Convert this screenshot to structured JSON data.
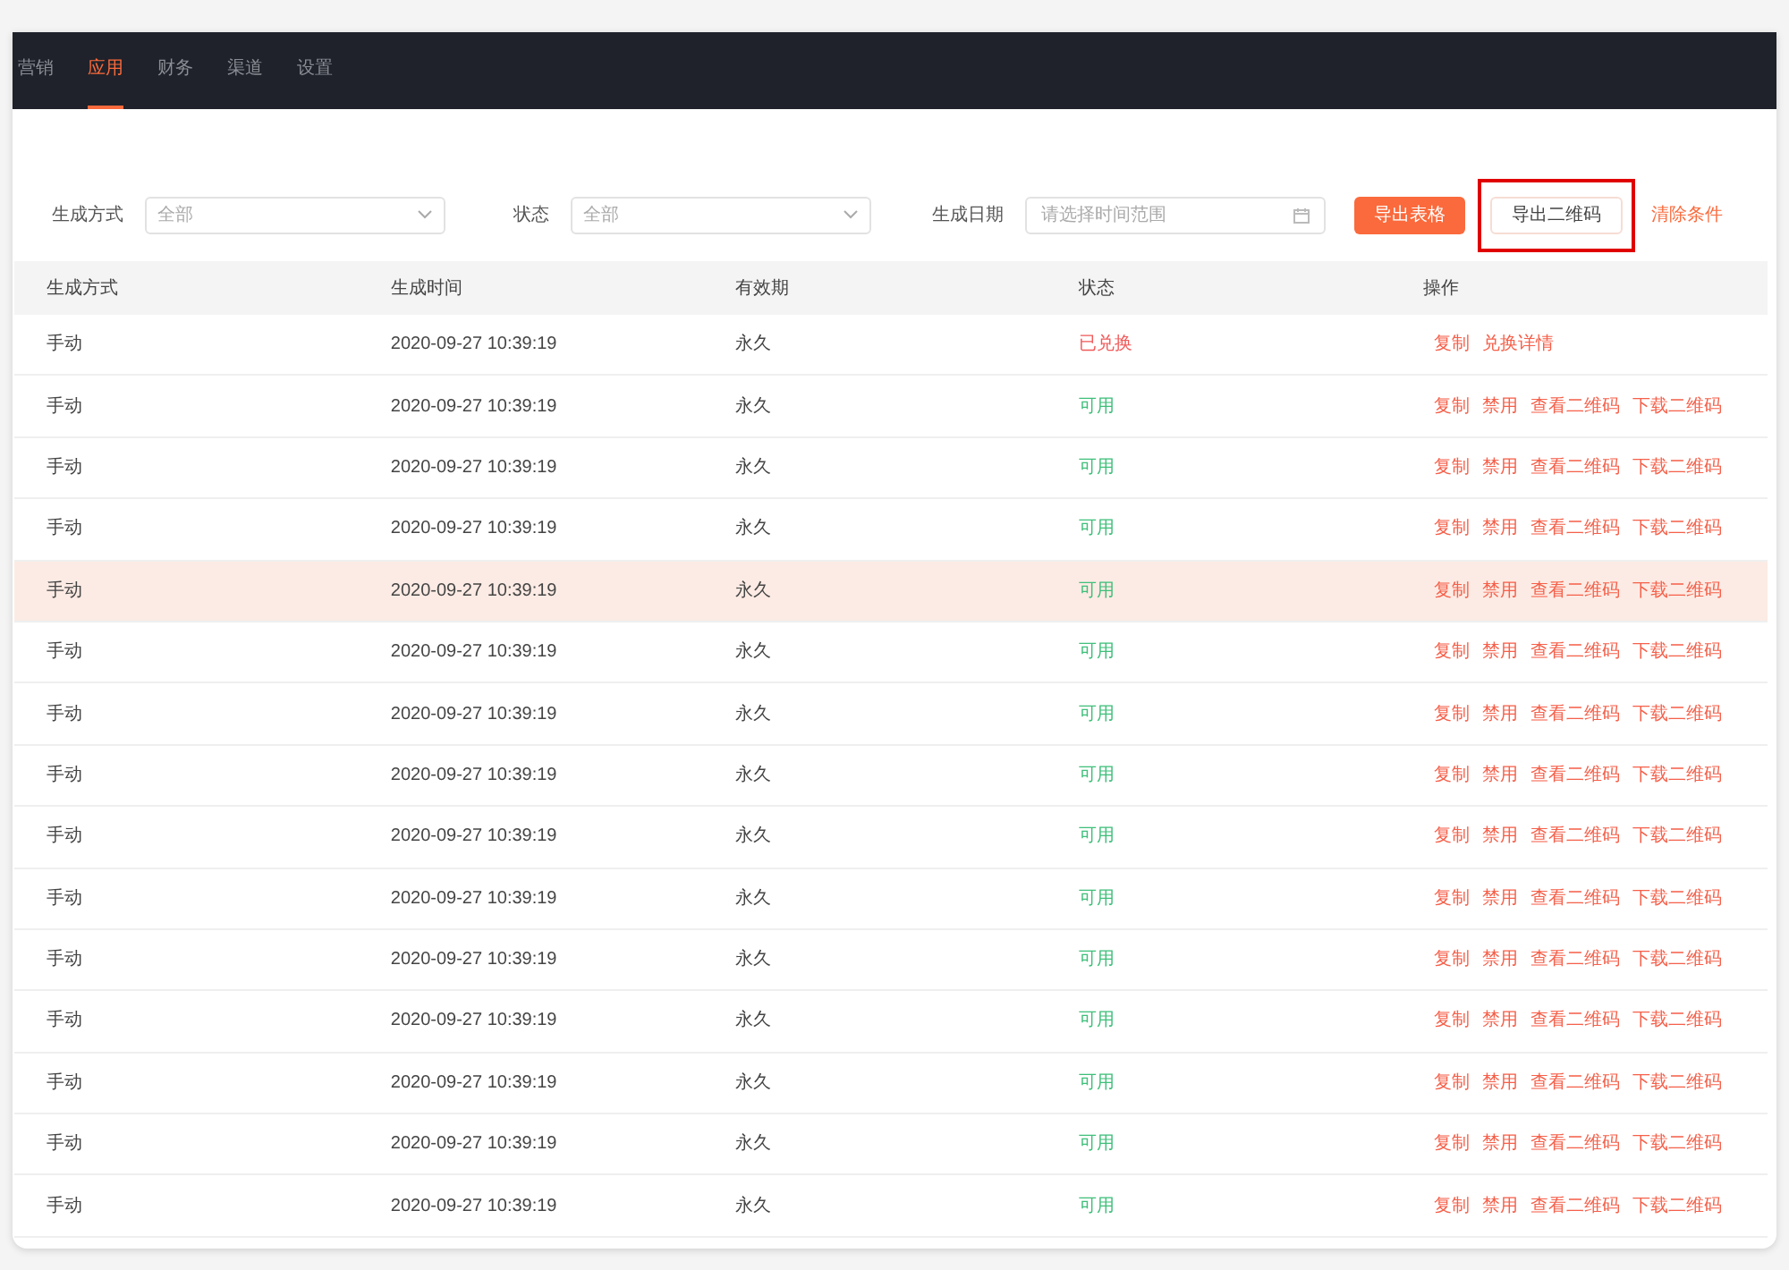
{
  "nav": {
    "tabs": [
      {
        "label": "营销",
        "selected": false
      },
      {
        "label": "应用",
        "selected": true
      },
      {
        "label": "财务",
        "selected": false
      },
      {
        "label": "渠道",
        "selected": false
      },
      {
        "label": "设置",
        "selected": false
      }
    ]
  },
  "filters": {
    "method": {
      "label": "生成方式",
      "value": "全部"
    },
    "status": {
      "label": "状态",
      "value": "全部"
    },
    "date": {
      "label": "生成日期",
      "placeholder": "请选择时间范围"
    }
  },
  "actions": [
    {
      "label": "导出表格",
      "kind": "primary",
      "highlighted": false
    },
    {
      "label": "导出二维码",
      "kind": "default",
      "highlighted": true
    },
    {
      "label": "清除条件",
      "kind": "text",
      "highlighted": false
    }
  ],
  "table": {
    "columns": [
      "生成方式",
      "生成时间",
      "有效期",
      "状态",
      "操作"
    ],
    "rows": [
      {
        "method": "手动",
        "time": "2020-09-27 10:39:19",
        "validity": "永久",
        "status": "已兑换",
        "kind": "redeemed",
        "highlighted": false,
        "ops": [
          "复制",
          "兑换详情"
        ]
      },
      {
        "method": "手动",
        "time": "2020-09-27 10:39:19",
        "validity": "永久",
        "status": "可用",
        "kind": "available",
        "highlighted": false,
        "ops": [
          "复制",
          "禁用",
          "查看二维码",
          "下载二维码"
        ]
      },
      {
        "method": "手动",
        "time": "2020-09-27 10:39:19",
        "validity": "永久",
        "status": "可用",
        "kind": "available",
        "highlighted": false,
        "ops": [
          "复制",
          "禁用",
          "查看二维码",
          "下载二维码"
        ]
      },
      {
        "method": "手动",
        "time": "2020-09-27 10:39:19",
        "validity": "永久",
        "status": "可用",
        "kind": "available",
        "highlighted": false,
        "ops": [
          "复制",
          "禁用",
          "查看二维码",
          "下载二维码"
        ]
      },
      {
        "method": "手动",
        "time": "2020-09-27 10:39:19",
        "validity": "永久",
        "status": "可用",
        "kind": "available",
        "highlighted": true,
        "ops": [
          "复制",
          "禁用",
          "查看二维码",
          "下载二维码"
        ]
      },
      {
        "method": "手动",
        "time": "2020-09-27 10:39:19",
        "validity": "永久",
        "status": "可用",
        "kind": "available",
        "highlighted": false,
        "ops": [
          "复制",
          "禁用",
          "查看二维码",
          "下载二维码"
        ]
      },
      {
        "method": "手动",
        "time": "2020-09-27 10:39:19",
        "validity": "永久",
        "status": "可用",
        "kind": "available",
        "highlighted": false,
        "ops": [
          "复制",
          "禁用",
          "查看二维码",
          "下载二维码"
        ]
      },
      {
        "method": "手动",
        "time": "2020-09-27 10:39:19",
        "validity": "永久",
        "status": "可用",
        "kind": "available",
        "highlighted": false,
        "ops": [
          "复制",
          "禁用",
          "查看二维码",
          "下载二维码"
        ]
      },
      {
        "method": "手动",
        "time": "2020-09-27 10:39:19",
        "validity": "永久",
        "status": "可用",
        "kind": "available",
        "highlighted": false,
        "ops": [
          "复制",
          "禁用",
          "查看二维码",
          "下载二维码"
        ]
      },
      {
        "method": "手动",
        "time": "2020-09-27 10:39:19",
        "validity": "永久",
        "status": "可用",
        "kind": "available",
        "highlighted": false,
        "ops": [
          "复制",
          "禁用",
          "查看二维码",
          "下载二维码"
        ]
      },
      {
        "method": "手动",
        "time": "2020-09-27 10:39:19",
        "validity": "永久",
        "status": "可用",
        "kind": "available",
        "highlighted": false,
        "ops": [
          "复制",
          "禁用",
          "查看二维码",
          "下载二维码"
        ]
      },
      {
        "method": "手动",
        "time": "2020-09-27 10:39:19",
        "validity": "永久",
        "status": "可用",
        "kind": "available",
        "highlighted": false,
        "ops": [
          "复制",
          "禁用",
          "查看二维码",
          "下载二维码"
        ]
      },
      {
        "method": "手动",
        "time": "2020-09-27 10:39:19",
        "validity": "永久",
        "status": "可用",
        "kind": "available",
        "highlighted": false,
        "ops": [
          "复制",
          "禁用",
          "查看二维码",
          "下载二维码"
        ]
      },
      {
        "method": "手动",
        "time": "2020-09-27 10:39:19",
        "validity": "永久",
        "status": "可用",
        "kind": "available",
        "highlighted": false,
        "ops": [
          "复制",
          "禁用",
          "查看二维码",
          "下载二维码"
        ]
      },
      {
        "method": "手动",
        "time": "2020-09-27 10:39:19",
        "validity": "永久",
        "status": "可用",
        "kind": "available",
        "highlighted": false,
        "ops": [
          "复制",
          "禁用",
          "查看二维码",
          "下载二维码"
        ]
      }
    ]
  }
}
